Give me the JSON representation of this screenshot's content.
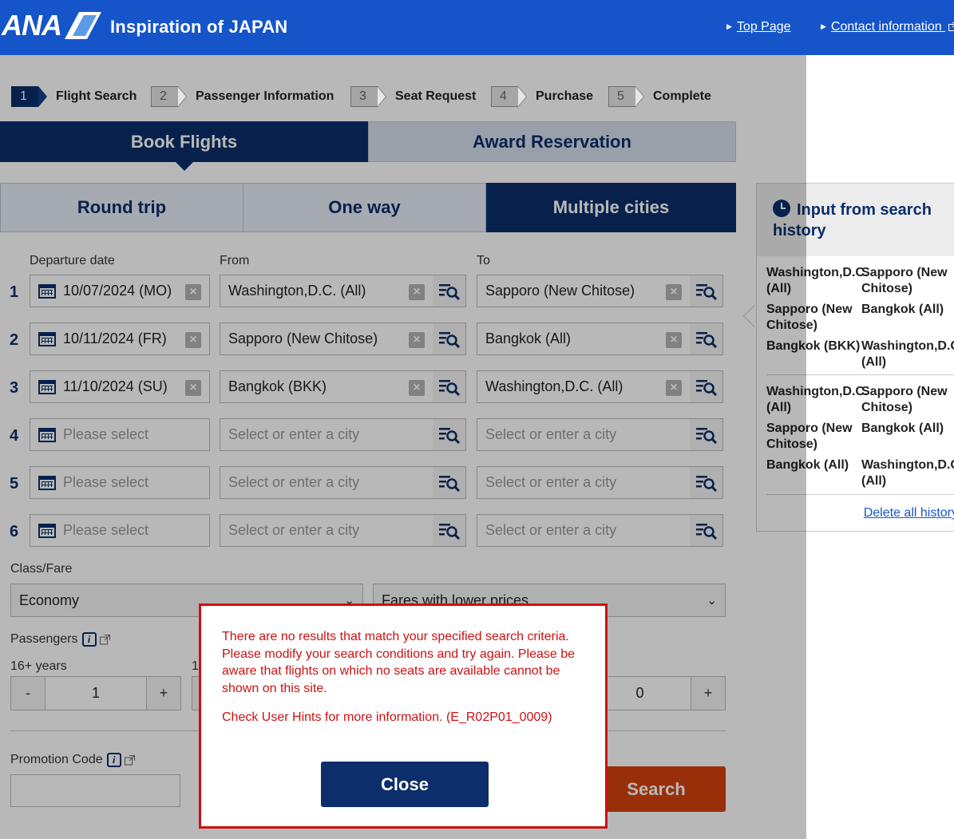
{
  "header": {
    "brand": "ANA",
    "tagline": "Inspiration of JAPAN",
    "top_page": "Top Page",
    "contact": "Contact information"
  },
  "steps": [
    {
      "num": "1",
      "label": "Flight Search"
    },
    {
      "num": "2",
      "label": "Passenger Information"
    },
    {
      "num": "3",
      "label": "Seat Request"
    },
    {
      "num": "4",
      "label": "Purchase"
    },
    {
      "num": "5",
      "label": "Complete"
    }
  ],
  "tabs": {
    "book": "Book Flights",
    "award": "Award Reservation"
  },
  "trip_types": {
    "round": "Round trip",
    "oneway": "One way",
    "multi": "Multiple cities"
  },
  "columns": {
    "date": "Departure date",
    "from": "From",
    "to": "To"
  },
  "rows": [
    {
      "num": "1",
      "date": "10/07/2024 (MO)",
      "from": "Washington,D.C. (All)",
      "to": "Sapporo (New Chitose)"
    },
    {
      "num": "2",
      "date": "10/11/2024 (FR)",
      "from": "Sapporo (New Chitose)",
      "to": "Bangkok (All)"
    },
    {
      "num": "3",
      "date": "11/10/2024 (SU)",
      "from": "Bangkok (BKK)",
      "to": "Washington,D.C. (All)"
    },
    {
      "num": "4",
      "date": "Please select",
      "from": "Select or enter a city",
      "to": "Select or enter a city"
    },
    {
      "num": "5",
      "date": "Please select",
      "from": "Select or enter a city",
      "to": "Select or enter a city"
    },
    {
      "num": "6",
      "date": "Please select",
      "from": "Select or enter a city",
      "to": "Select or enter a city"
    }
  ],
  "fare": {
    "label": "Class/Fare",
    "class_value": "Economy",
    "fare_value": "Fares with lower prices"
  },
  "passengers": {
    "label": "Passengers",
    "age1_label": "16+ years",
    "age2_label": "1",
    "minus": "-",
    "plus": "+",
    "count1": "1",
    "count3": "0"
  },
  "promo": {
    "label": "Promotion Code",
    "value": ""
  },
  "search_button": "Search",
  "history": {
    "title": "Input from search history",
    "groups": [
      [
        [
          "Washington,D.C. (All)",
          "Sapporo (New Chitose)"
        ],
        [
          "Sapporo (New Chitose)",
          "Bangkok (All)"
        ],
        [
          "Bangkok (BKK)",
          "Washington,D.C. (All)"
        ]
      ],
      [
        [
          "Washington,D.C. (All)",
          "Sapporo (New Chitose)"
        ],
        [
          "Sapporo (New Chitose)",
          "Bangkok (All)"
        ],
        [
          "Bangkok (All)",
          "Washington,D.C. (All)"
        ]
      ]
    ],
    "delete": "Delete all history"
  },
  "dialog": {
    "message": "There are no results that match your specified search criteria. Please modify your search conditions and try again. Please be aware that flights on which no seats are available cannot be shown on this site.",
    "hint": "Check User Hints for more information. (E_R02P01_0009)",
    "close": "Close"
  },
  "colors": {
    "header_blue": "#1655c9",
    "navy": "#0c2e6a",
    "error_red": "#cc1111",
    "search_orange": "#d4420c"
  }
}
